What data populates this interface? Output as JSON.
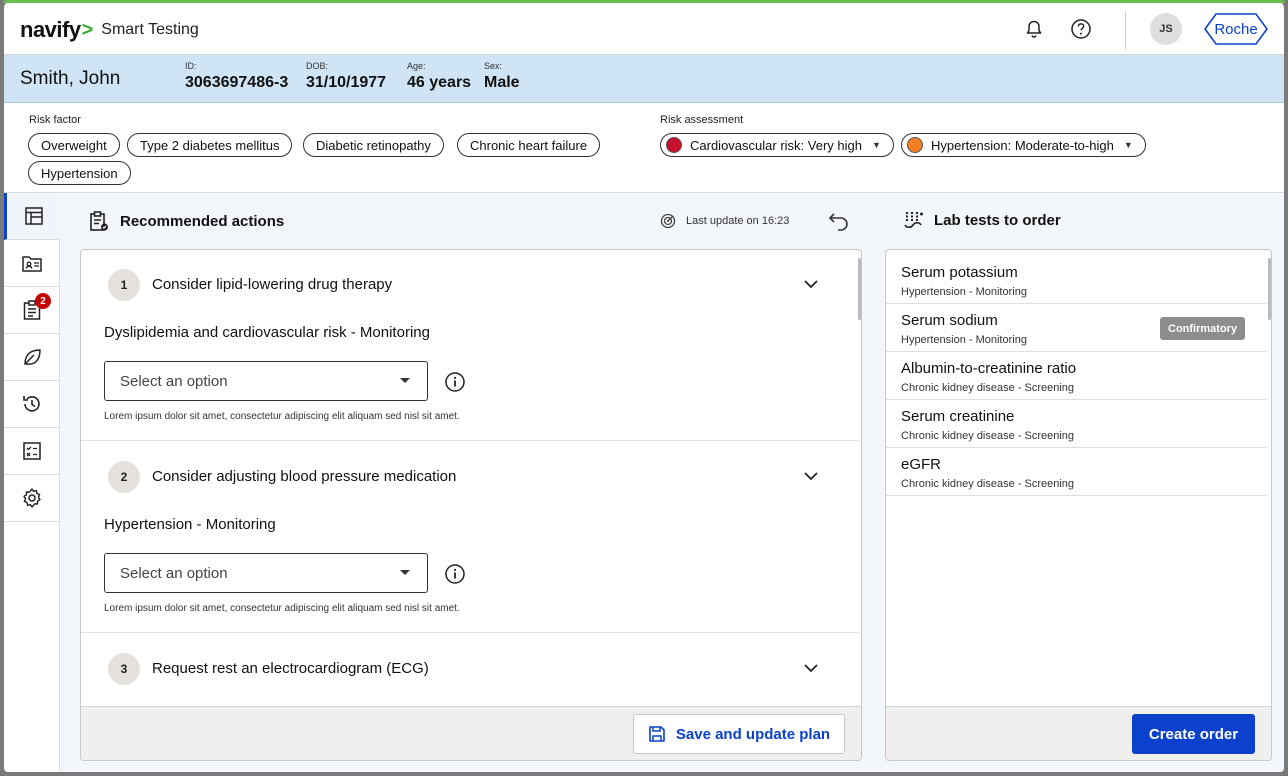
{
  "app": {
    "logo": "navify",
    "name": "Smart Testing",
    "user_initials": "JS",
    "brand": "Roche"
  },
  "patient": {
    "name": "Smith,  John",
    "id_label": "ID:",
    "id": "3063697486-3",
    "dob_label": "DOB:",
    "dob": "31/10/1977",
    "age_label": "Age:",
    "age": "46 years",
    "sex_label": "Sex:",
    "sex": "Male"
  },
  "risk_factor": {
    "label": "Risk factor",
    "items": [
      "Overweight",
      "Type 2 diabetes mellitus",
      "Diabetic retinopathy",
      "Chronic heart failure",
      "Hypertension"
    ]
  },
  "risk_assessment": {
    "label": "Risk assessment",
    "items": [
      {
        "label": "Cardiovascular risk: Very high",
        "color": "#c8102e"
      },
      {
        "label": "Hypertension: Moderate-to-high",
        "color": "#f57f25"
      }
    ]
  },
  "rail": {
    "badge_count": "2"
  },
  "recommended": {
    "title": "Recommended actions",
    "last_update": "Last update on 16:23",
    "items": [
      {
        "num": "1",
        "title": "Consider lipid-lowering drug therapy",
        "subtitle": "Dyslipidemia and cardiovascular risk - Monitoring",
        "placeholder": "Select an option",
        "help": "Lorem ipsum dolor sit amet, consectetur adipiscing elit aliquam sed nisl sit amet."
      },
      {
        "num": "2",
        "title": "Consider adjusting blood pressure medication",
        "subtitle": "Hypertension - Monitoring",
        "placeholder": "Select an option",
        "help": "Lorem ipsum dolor sit amet, consectetur adipiscing elit aliquam sed nisl sit amet."
      },
      {
        "num": "3",
        "title": "Request rest an electrocardiogram (ECG)"
      }
    ],
    "save_label": "Save and update plan"
  },
  "lab": {
    "title": "Lab tests to order",
    "tests": [
      {
        "name": "Serum potassium",
        "sub": "Hypertension - Monitoring"
      },
      {
        "name": "Serum sodium",
        "sub": "Hypertension - Monitoring",
        "tag": "Confirmatory"
      },
      {
        "name": "Albumin-to-creatinine ratio",
        "sub": "Chronic kidney disease - Screening"
      },
      {
        "name": "Serum creatinine",
        "sub": "Chronic kidney disease - Screening"
      },
      {
        "name": "eGFR",
        "sub": "Chronic kidney disease - Screening"
      }
    ],
    "create_label": "Create order"
  },
  "colors": {
    "accent": "#0b41cd",
    "patient_bar": "#cfe5f5",
    "brand_green": "#3aaa35"
  }
}
